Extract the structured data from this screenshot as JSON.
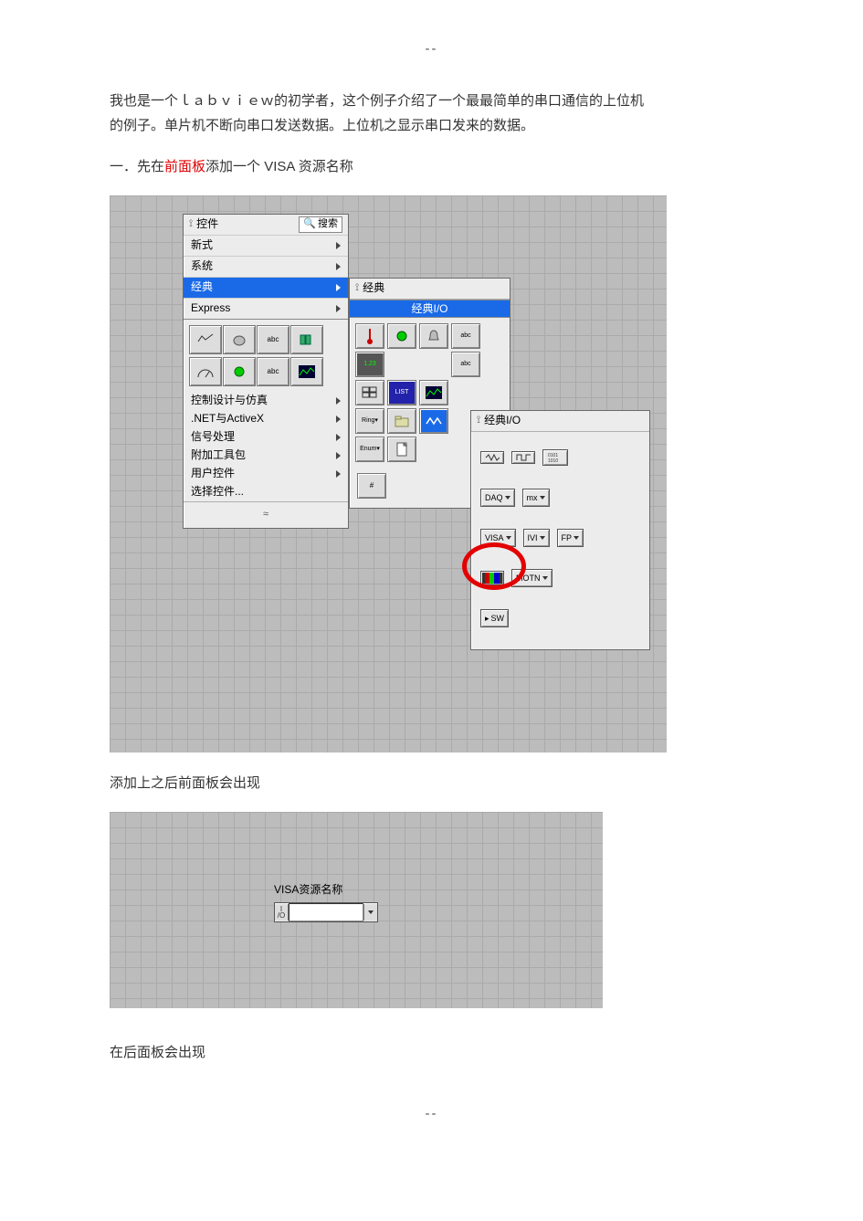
{
  "sep": "--",
  "intro": {
    "line1": "我也是一个ｌａｂｖｉｅｗ的初学者，这个例子介绍了一个最最简单的串口通信的上位机",
    "line2": "的例子。单片机不断向串口发送数据。上位机之显示串口发来的数据。"
  },
  "step1_prefix": "一．先在",
  "step1_red": "前面板",
  "step1_suffix": "添加一个 VISA 资源名称",
  "palette_main": {
    "title": "控件",
    "search": "搜索",
    "items": {
      "new": "新式",
      "system": "系统",
      "classic": "经典",
      "express": "Express"
    },
    "text_items": {
      "ctrlsim": "控制设计与仿真",
      "dotnet": ".NET与ActiveX",
      "signal": "信号处理",
      "addon": "附加工具包",
      "userctrl": "用户控件",
      "select": "选择控件..."
    },
    "collapse": "≈"
  },
  "palette_classic": {
    "title": "经典",
    "header": "经典I/O"
  },
  "palette_io": {
    "title": "经典I/O",
    "btns": {
      "daq": "DAQ",
      "mx": "mx",
      "visa": "VISA",
      "ivi": "IVI",
      "fp": "FP",
      "motn": "MOTN",
      "sw": "SW"
    }
  },
  "after_add": "添加上之后前面板会出现",
  "visa_control_label": "VISA资源名称",
  "after_add2": "在后面板会出现"
}
